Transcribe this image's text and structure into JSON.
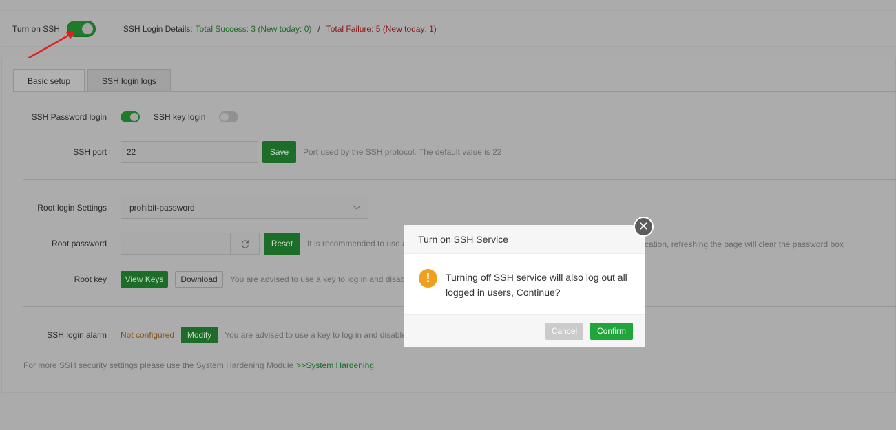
{
  "topbar": {
    "ssh_label": "Turn on SSH",
    "details_label": "SSH Login Details:",
    "success_text": "Total Success: 3 (New today: 0)",
    "separator": "/",
    "failure_text": "Total Failure: 5 (New today: 1)"
  },
  "tabs": [
    {
      "label": "Basic setup"
    },
    {
      "label": "SSH login logs"
    }
  ],
  "form": {
    "password_login_label": "SSH Password login",
    "key_login_label": "SSH key login",
    "port_label": "SSH port",
    "port_value": "22",
    "save_label": "Save",
    "port_hint": "Port used by the SSH protocol. The default value is 22",
    "root_login_label": "Root login Settings",
    "root_login_value": "prohibit-password",
    "root_password_label": "Root password",
    "reset_label": "Reset",
    "root_password_hint_left": "It is recommended to use a",
    "root_password_hint_right": "cation, refreshing the page will clear the password box",
    "root_key_label": "Root key",
    "view_keys_label": "View Keys",
    "download_label": "Download",
    "root_key_hint": "You are advised to use a key to log in and disabl",
    "alarm_label": "SSH login alarm",
    "alarm_status": "Not configured",
    "modify_label": "Modify",
    "alarm_hint": "You are advised to use a key to log in and disable",
    "footer_text": "For more SSH security settings please use the System Hardening Module",
    "footer_link": ">>System Hardening"
  },
  "modal": {
    "title": "Turn on SSH Service",
    "icon_glyph": "!",
    "message": "Turning off SSH service will also log out all logged in users, Continue?",
    "cancel_label": "Cancel",
    "confirm_label": "Confirm",
    "close_glyph": "✕"
  },
  "colors": {
    "accent_green": "#20a53a",
    "warning_orange": "#f0a020",
    "arrow_red": "#e02020"
  }
}
